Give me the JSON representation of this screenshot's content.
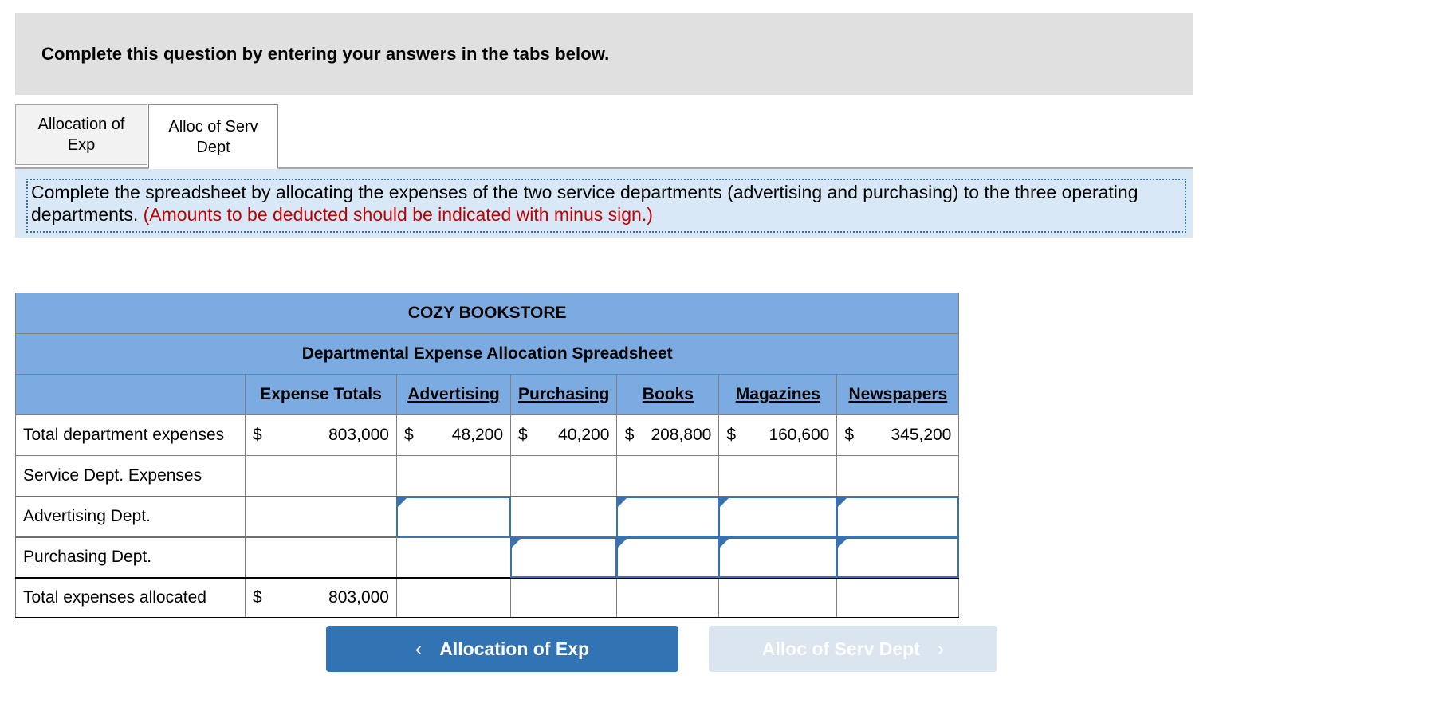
{
  "banner": {
    "text": "Complete this question by entering your answers in the tabs below."
  },
  "tabs": [
    {
      "label": "Allocation of Exp",
      "active": false
    },
    {
      "label": "Alloc of Serv Dept",
      "active": true
    }
  ],
  "instruction": {
    "main": "Complete the spreadsheet by allocating the expenses of the two service departments (advertising and purchasing) to the three operating departments.",
    "note": "(Amounts to be deducted should be indicated with minus sign.)",
    "note_color": "#c00000"
  },
  "spreadsheet": {
    "title": "COZY BOOKSTORE",
    "subtitle": "Departmental Expense Allocation Spreadsheet",
    "accent_color": "#7cabe2",
    "column_headers": [
      "",
      "Expense Totals",
      "Advertising",
      "Purchasing",
      "Books",
      "Magazines",
      "Newspapers"
    ],
    "rows": [
      {
        "label": "Total department expenses",
        "cells": [
          {
            "type": "value",
            "dollar": "$",
            "amount": "803,000"
          },
          {
            "type": "value",
            "dollar": "$",
            "amount": "48,200"
          },
          {
            "type": "value",
            "dollar": "$",
            "amount": "40,200"
          },
          {
            "type": "value",
            "dollar": "$",
            "amount": "208,800"
          },
          {
            "type": "value",
            "dollar": "$",
            "amount": "160,600"
          },
          {
            "type": "value",
            "dollar": "$",
            "amount": "345,200"
          }
        ]
      },
      {
        "label": "Service Dept. Expenses",
        "cells": [
          {
            "type": "blank"
          },
          {
            "type": "blank"
          },
          {
            "type": "blank"
          },
          {
            "type": "blank"
          },
          {
            "type": "blank"
          },
          {
            "type": "blank"
          }
        ]
      },
      {
        "label": "Advertising Dept.",
        "cells": [
          {
            "type": "blank"
          },
          {
            "type": "input",
            "value": ""
          },
          {
            "type": "blank"
          },
          {
            "type": "input",
            "value": ""
          },
          {
            "type": "input",
            "value": ""
          },
          {
            "type": "input",
            "value": ""
          }
        ]
      },
      {
        "label": "Purchasing Dept.",
        "cells": [
          {
            "type": "blank"
          },
          {
            "type": "blank"
          },
          {
            "type": "input",
            "value": ""
          },
          {
            "type": "input",
            "value": ""
          },
          {
            "type": "input",
            "value": ""
          },
          {
            "type": "input",
            "value": ""
          }
        ]
      },
      {
        "label": "Total expenses allocated",
        "cells": [
          {
            "type": "value",
            "dollar": "$",
            "amount": "803,000"
          },
          {
            "type": "blank"
          },
          {
            "type": "blank"
          },
          {
            "type": "blank"
          },
          {
            "type": "blank"
          },
          {
            "type": "blank"
          }
        ]
      }
    ]
  },
  "nav": {
    "prev_label": "Allocation of Exp",
    "prev_chevron": "‹",
    "prev_color": "#3273b4",
    "next_label": "Alloc of Serv Dept",
    "next_chevron": "›",
    "next_color": "#dae5f0"
  }
}
